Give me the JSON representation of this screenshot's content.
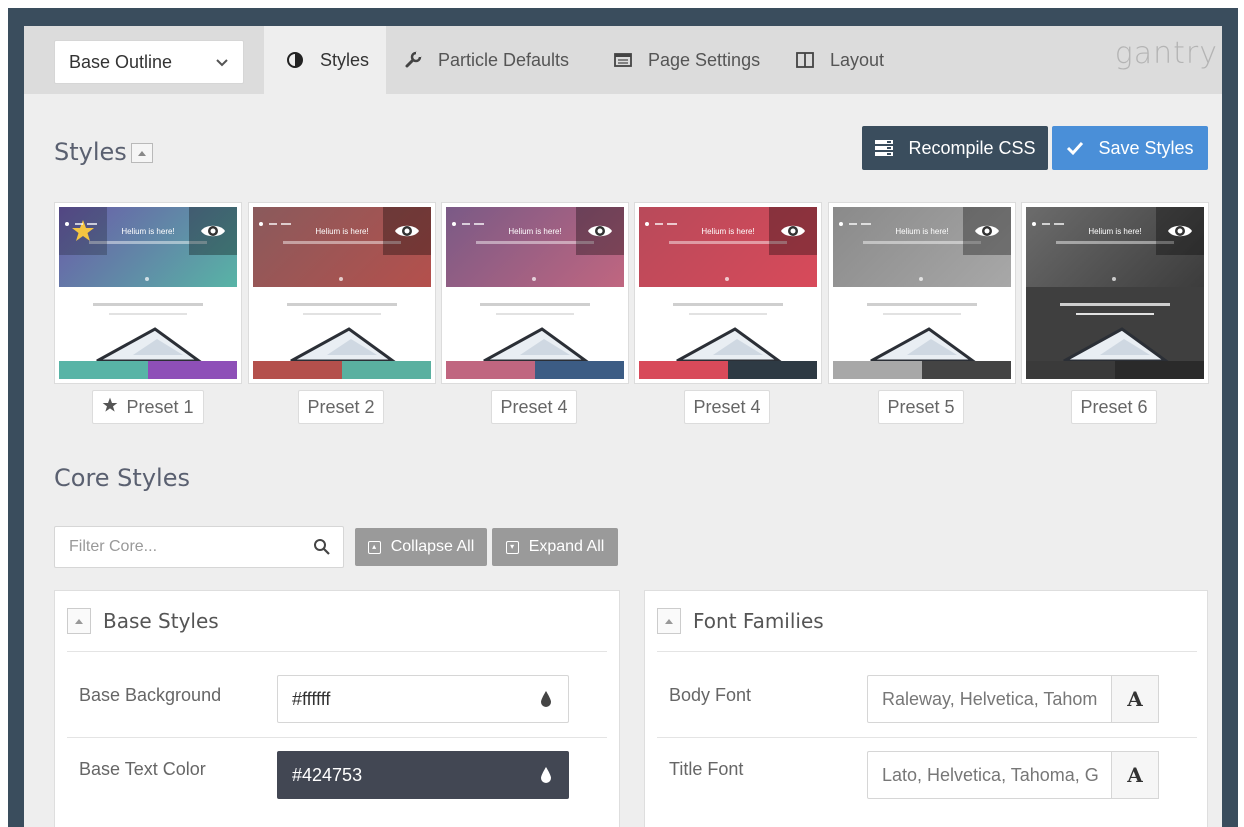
{
  "nav": {
    "outline_select": "Base Outline",
    "tabs": [
      {
        "label": "Styles",
        "icon": "contrast-icon"
      },
      {
        "label": "Particle Defaults",
        "icon": "wrench-icon"
      },
      {
        "label": "Page Settings",
        "icon": "page-icon"
      },
      {
        "label": "Layout",
        "icon": "columns-icon"
      }
    ],
    "brand": "gantry"
  },
  "styles_section": {
    "title": "Styles",
    "recompile_label": "Recompile CSS",
    "save_label": "Save Styles"
  },
  "presets": [
    {
      "label": "Preset 1",
      "hero_text": "Helium is here!",
      "hero": "#6a5aa8",
      "colors": [
        "#58b4a6",
        "#8e4fb8"
      ],
      "starred": true
    },
    {
      "label": "Preset 2",
      "hero_text": "Helium is here!",
      "hero": "#8a5a5c",
      "colors": [
        "#b4504c",
        "#5ab0a0"
      ],
      "starred": false
    },
    {
      "label": "Preset 4",
      "hero_text": "Helium is here!",
      "hero": "#7a5a86",
      "colors": [
        "#c06680",
        "#3c5c84"
      ],
      "starred": false
    },
    {
      "label": "Preset 4",
      "hero_text": "Helium is here!",
      "hero": "#b84a5a",
      "colors": [
        "#d84a5a",
        "#2e3a44"
      ],
      "starred": false
    },
    {
      "label": "Preset 5",
      "hero_text": "Helium is here!",
      "hero": "#8a8a8a",
      "colors": [
        "#a8a8a8",
        "#444444"
      ],
      "starred": false
    },
    {
      "label": "Preset 6",
      "hero_text": "Helium is here!",
      "hero": "#6c6c6c",
      "colors": [
        "#3a3a3a",
        "#2a2a2a"
      ],
      "starred": false
    }
  ],
  "core_styles": {
    "title": "Core Styles",
    "filter_placeholder": "Filter Core...",
    "collapse_all": "Collapse All",
    "expand_all": "Expand All"
  },
  "base_styles": {
    "title": "Base Styles",
    "rows": [
      {
        "label": "Base Background",
        "value": "#ffffff"
      },
      {
        "label": "Base Text Color",
        "value": "#424753"
      }
    ]
  },
  "font_families": {
    "title": "Font Families",
    "rows": [
      {
        "label": "Body Font",
        "value": "Raleway, Helvetica, Tahom",
        "button": "A"
      },
      {
        "label": "Title Font",
        "value": "Lato, Helvetica, Tahoma, G",
        "button": "A"
      }
    ]
  },
  "colors": {
    "dark_button": "#3a4d5d",
    "primary_button": "#4a8fd8",
    "grey_button": "#9a9a9a"
  }
}
